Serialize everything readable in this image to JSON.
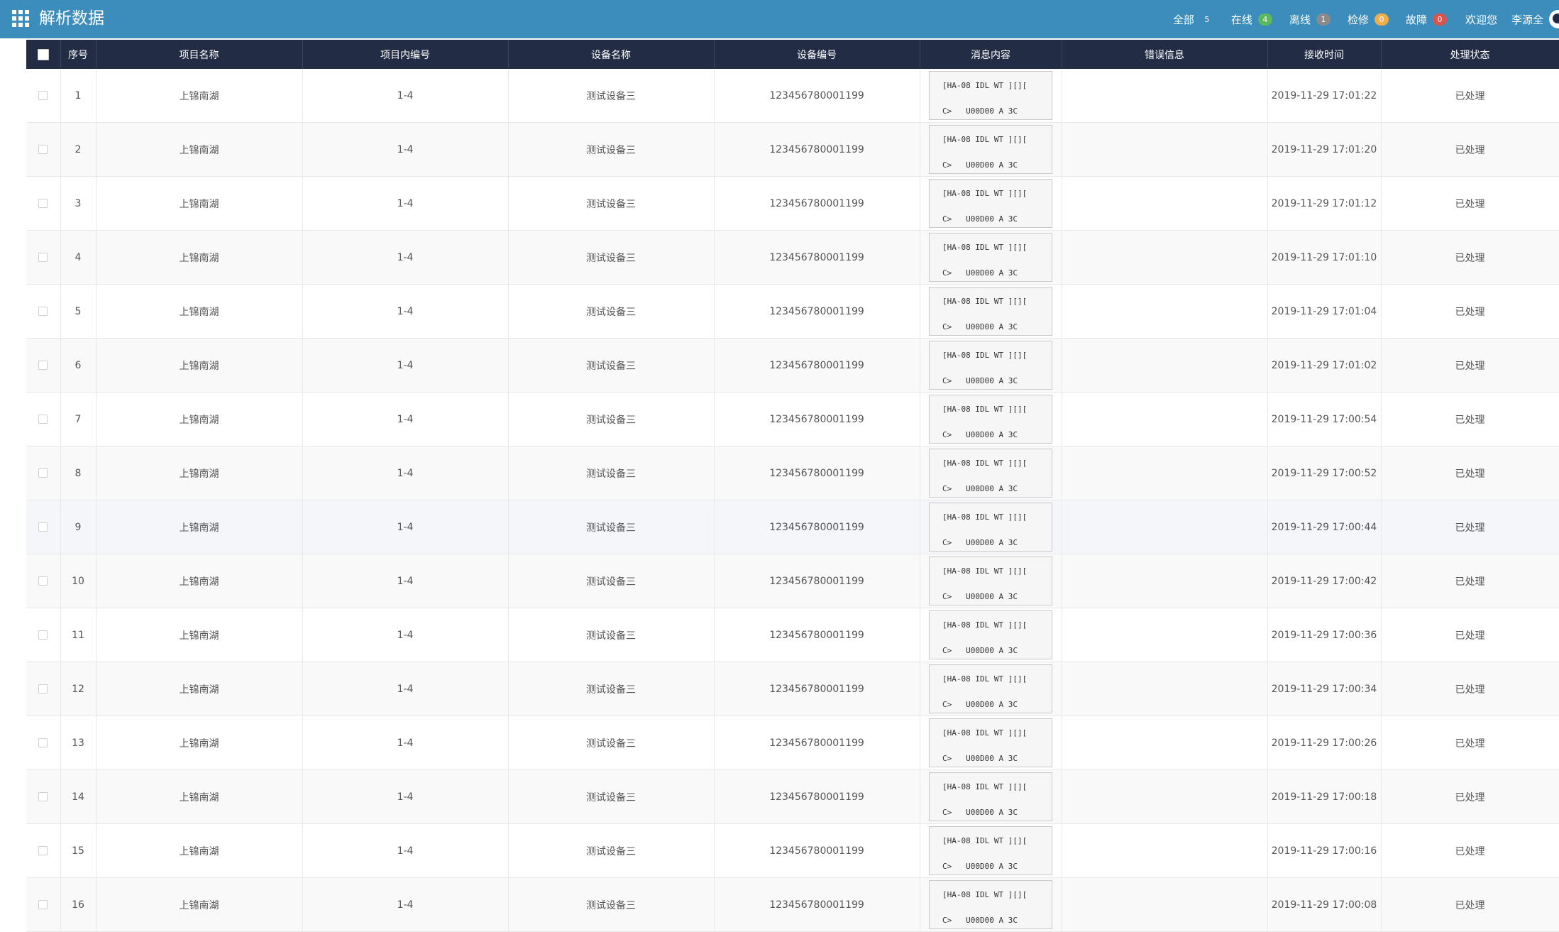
{
  "header": {
    "title": "解析数据",
    "statuses": [
      {
        "label": "全部",
        "count": "5",
        "color": "#3c8dbc"
      },
      {
        "label": "在线",
        "count": "4",
        "color": "#5cb85c"
      },
      {
        "label": "离线",
        "count": "1",
        "color": "#8a8a8a"
      },
      {
        "label": "检修",
        "count": "0",
        "color": "#f0ad4e"
      },
      {
        "label": "故障",
        "count": "0",
        "color": "#d9534f"
      }
    ],
    "welcome": "欢迎您",
    "username": "李源全"
  },
  "table": {
    "columns": [
      "序号",
      "项目名称",
      "项目内编号",
      "设备名称",
      "设备编号",
      "消息内容",
      "错误信息",
      "接收时间",
      "处理状态"
    ],
    "rows": [
      {
        "no": "1",
        "project": "上锦南湖",
        "code": "1-4",
        "device": "测试设备三",
        "device_no": "123456780001199",
        "msg1": "[HA-08 IDL WT ][][",
        "msg2": "C>   U00D00 A 3C",
        "error": "",
        "time": "2019-11-29 17:01:22",
        "status": "已处理"
      },
      {
        "no": "2",
        "project": "上锦南湖",
        "code": "1-4",
        "device": "测试设备三",
        "device_no": "123456780001199",
        "msg1": "[HA-08 IDL WT ][][",
        "msg2": "C>   U00D00 A 3C",
        "error": "",
        "time": "2019-11-29 17:01:20",
        "status": "已处理"
      },
      {
        "no": "3",
        "project": "上锦南湖",
        "code": "1-4",
        "device": "测试设备三",
        "device_no": "123456780001199",
        "msg1": "[HA-08 IDL WT ][][",
        "msg2": "C>   U00D00 A 3C",
        "error": "",
        "time": "2019-11-29 17:01:12",
        "status": "已处理"
      },
      {
        "no": "4",
        "project": "上锦南湖",
        "code": "1-4",
        "device": "测试设备三",
        "device_no": "123456780001199",
        "msg1": "[HA-08 IDL WT ][][",
        "msg2": "C>   U00D00 A 3C",
        "error": "",
        "time": "2019-11-29 17:01:10",
        "status": "已处理"
      },
      {
        "no": "5",
        "project": "上锦南湖",
        "code": "1-4",
        "device": "测试设备三",
        "device_no": "123456780001199",
        "msg1": "[HA-08 IDL WT ][][",
        "msg2": "C>   U00D00 A 3C",
        "error": "",
        "time": "2019-11-29 17:01:04",
        "status": "已处理"
      },
      {
        "no": "6",
        "project": "上锦南湖",
        "code": "1-4",
        "device": "测试设备三",
        "device_no": "123456780001199",
        "msg1": "[HA-08 IDL WT ][][",
        "msg2": "C>   U00D00 A 3C",
        "error": "",
        "time": "2019-11-29 17:01:02",
        "status": "已处理"
      },
      {
        "no": "7",
        "project": "上锦南湖",
        "code": "1-4",
        "device": "测试设备三",
        "device_no": "123456780001199",
        "msg1": "[HA-08 IDL WT ][][",
        "msg2": "C>   U00D00 A 3C",
        "error": "",
        "time": "2019-11-29 17:00:54",
        "status": "已处理"
      },
      {
        "no": "8",
        "project": "上锦南湖",
        "code": "1-4",
        "device": "测试设备三",
        "device_no": "123456780001199",
        "msg1": "[HA-08 IDL WT ][][",
        "msg2": "C>   U00D00 A 3C",
        "error": "",
        "time": "2019-11-29 17:00:52",
        "status": "已处理"
      },
      {
        "no": "9",
        "project": "上锦南湖",
        "code": "1-4",
        "device": "测试设备三",
        "device_no": "123456780001199",
        "msg1": "[HA-08 IDL WT ][][",
        "msg2": "C>   U00D00 A 3C",
        "error": "",
        "time": "2019-11-29 17:00:44",
        "status": "已处理"
      },
      {
        "no": "10",
        "project": "上锦南湖",
        "code": "1-4",
        "device": "测试设备三",
        "device_no": "123456780001199",
        "msg1": "[HA-08 IDL WT ][][",
        "msg2": "C>   U00D00 A 3C",
        "error": "",
        "time": "2019-11-29 17:00:42",
        "status": "已处理"
      },
      {
        "no": "11",
        "project": "上锦南湖",
        "code": "1-4",
        "device": "测试设备三",
        "device_no": "123456780001199",
        "msg1": "[HA-08 IDL WT ][][",
        "msg2": "C>   U00D00 A 3C",
        "error": "",
        "time": "2019-11-29 17:00:36",
        "status": "已处理"
      },
      {
        "no": "12",
        "project": "上锦南湖",
        "code": "1-4",
        "device": "测试设备三",
        "device_no": "123456780001199",
        "msg1": "[HA-08 IDL WT ][][",
        "msg2": "C>   U00D00 A 3C",
        "error": "",
        "time": "2019-11-29 17:00:34",
        "status": "已处理"
      },
      {
        "no": "13",
        "project": "上锦南湖",
        "code": "1-4",
        "device": "测试设备三",
        "device_no": "123456780001199",
        "msg1": "[HA-08 IDL WT ][][",
        "msg2": "C>   U00D00 A 3C",
        "error": "",
        "time": "2019-11-29 17:00:26",
        "status": "已处理"
      },
      {
        "no": "14",
        "project": "上锦南湖",
        "code": "1-4",
        "device": "测试设备三",
        "device_no": "123456780001199",
        "msg1": "[HA-08 IDL WT ][][",
        "msg2": "C>   U00D00 A 3C",
        "error": "",
        "time": "2019-11-29 17:00:18",
        "status": "已处理"
      },
      {
        "no": "15",
        "project": "上锦南湖",
        "code": "1-4",
        "device": "测试设备三",
        "device_no": "123456780001199",
        "msg1": "[HA-08 IDL WT ][][",
        "msg2": "C>   U00D00 A 3C",
        "error": "",
        "time": "2019-11-29 17:00:16",
        "status": "已处理"
      },
      {
        "no": "16",
        "project": "上锦南湖",
        "code": "1-4",
        "device": "测试设备三",
        "device_no": "123456780001199",
        "msg1": "[HA-08 IDL WT ][][",
        "msg2": "C>   U00D00 A 3C",
        "error": "",
        "time": "2019-11-29 17:00:08",
        "status": "已处理"
      }
    ]
  }
}
